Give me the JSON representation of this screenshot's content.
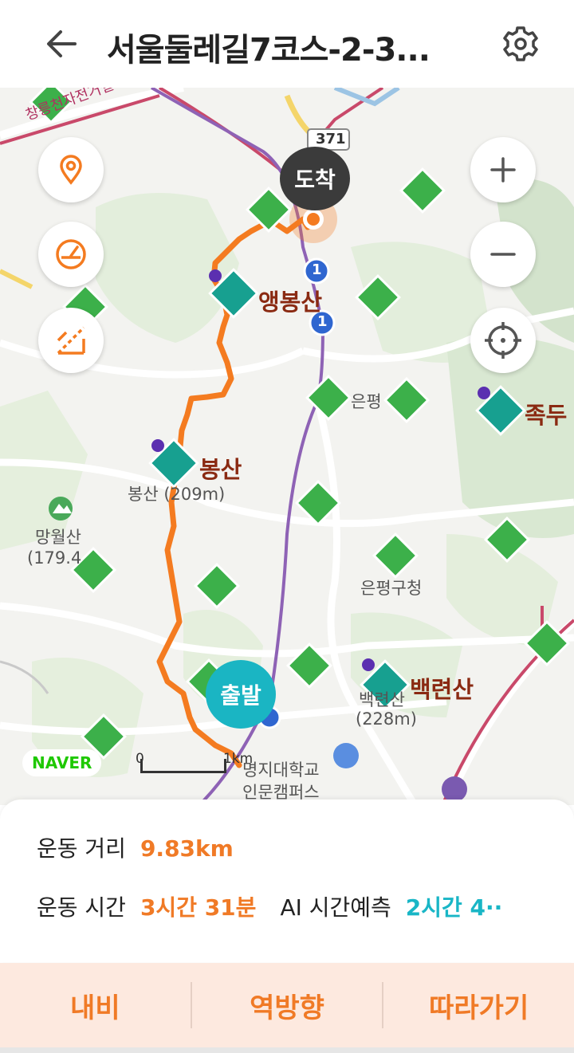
{
  "header": {
    "title": "서울둘레길7코스-2-3...",
    "back_icon": "arrow-left-icon",
    "settings_icon": "gear-icon"
  },
  "map": {
    "markers": {
      "arrive": "도착",
      "start": "출발"
    },
    "peaks": {
      "haengbongsan": "앵봉산",
      "bongsan": "봉산",
      "bongsan_elev": "봉산 (209m)",
      "baengnyeonsan": "백련산",
      "baengnyeonsan_elev": "(228m)",
      "baengnyeonsan_sub": "백련산",
      "jokdu": "족두",
      "mangwolsan": "망월산",
      "mangwolsan_elev": "(179.4"
    },
    "places": {
      "eunpyeong": "은평",
      "eunpyeong_gucheong": "은평구청",
      "myongji_line1": "명지대학교",
      "myongji_line2": "인문캠퍼스",
      "bike_road": "창릉천자전거길",
      "route_371": "371",
      "route_1a": "1",
      "route_1b": "1"
    },
    "logo": "NAVER",
    "scale": {
      "zero": "0",
      "km": "1km"
    },
    "controls": {
      "location_icon": "map-pin-icon",
      "speed_icon": "speedometer-icon",
      "elevation_icon": "elevation-icon",
      "zoom_in_icon": "plus-icon",
      "zoom_out_icon": "minus-icon",
      "gps_icon": "crosshair-icon"
    },
    "colors": {
      "route": "#f47b20",
      "start": "#1ab5c3",
      "arrive": "#3b3b3b",
      "poi": "#8a2a12"
    }
  },
  "stats": {
    "distance_label": "운동 거리",
    "distance_value": "9.83km",
    "time_label": "운동 시간",
    "time_value": "3시간 31분",
    "ai_label": "AI 시간예측",
    "ai_value": "2시간 4··"
  },
  "actions": {
    "navi": "내비",
    "reverse": "역방향",
    "follow": "따라가기"
  }
}
